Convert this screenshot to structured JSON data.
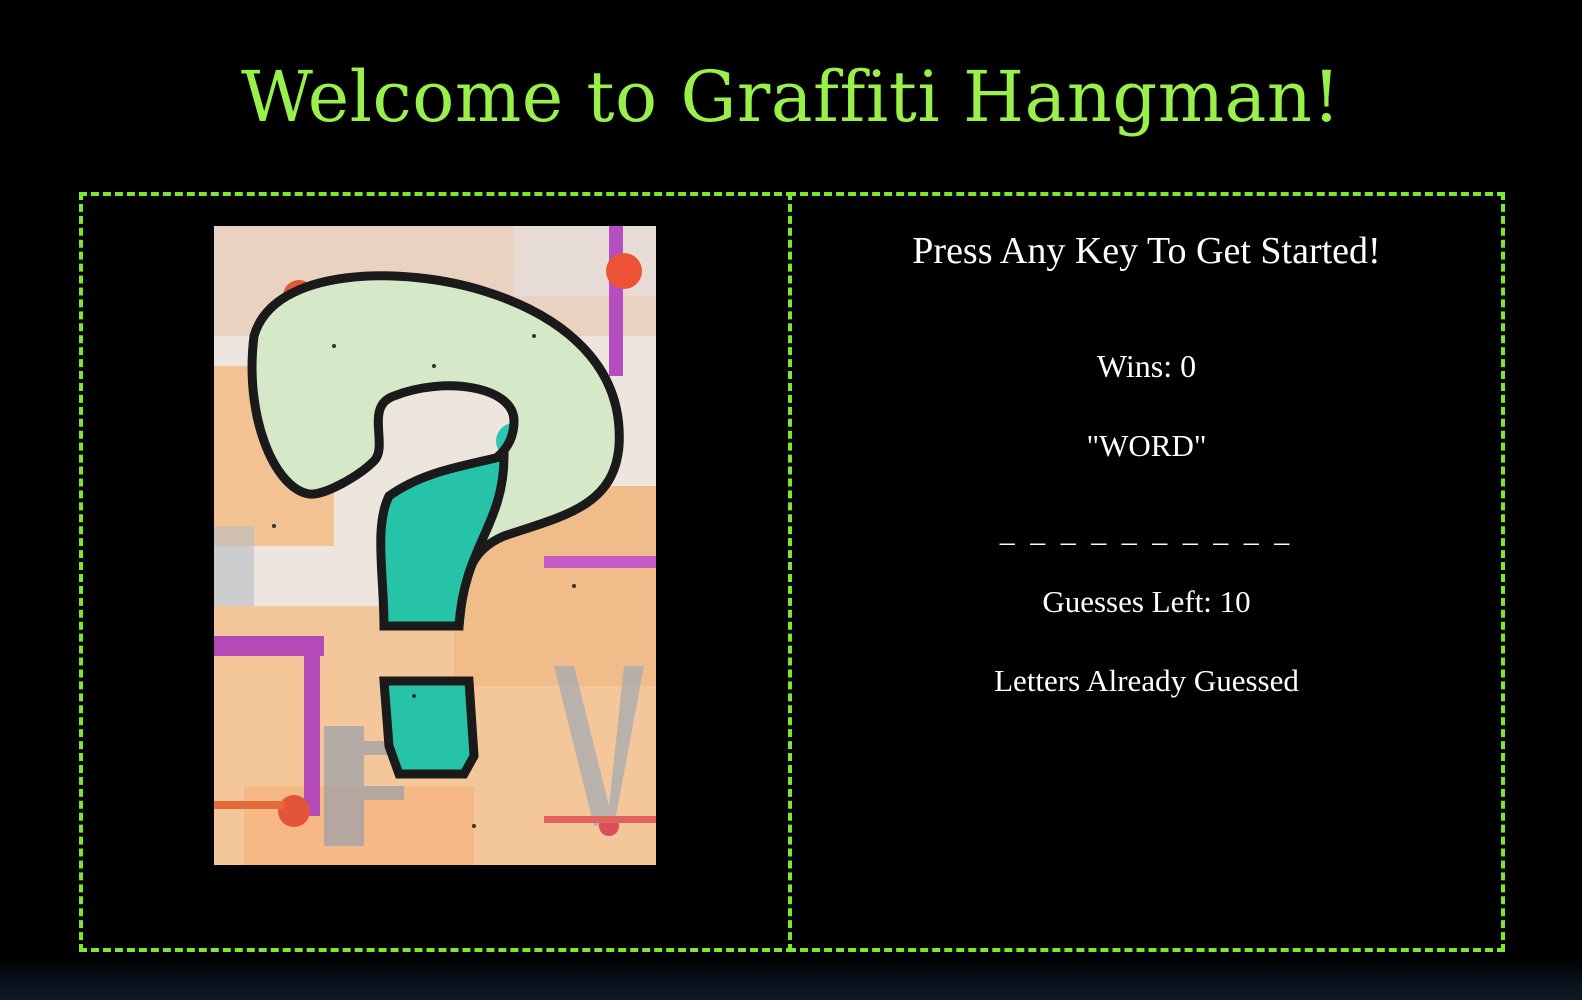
{
  "title": "Welcome to Graffiti Hangman!",
  "image": {
    "subject": "graffiti question mark",
    "icon": "question-mark-graffiti-icon"
  },
  "game": {
    "prompt": "Press Any Key To Get Started!",
    "wins": "Wins: 0",
    "word": "\"WORD\"",
    "blanks": "_ _ _ _ _ _ _ _ _ _",
    "guesses_left": "Guesses Left: 10",
    "letters_guessed_label": "Letters Already Guessed"
  },
  "colors": {
    "background": "#000000",
    "title": "#9af04a",
    "border": "#7ae82c",
    "text": "#ffffff"
  }
}
